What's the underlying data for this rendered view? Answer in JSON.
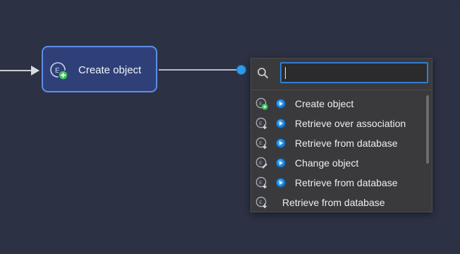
{
  "node": {
    "label": "Create object",
    "icon": "create-object-icon"
  },
  "search": {
    "value": "",
    "icon": "search-icon"
  },
  "colors": {
    "canvas": "#2c3244",
    "node_fill": "#2f4079",
    "node_border": "#5f8ee8",
    "accent": "#2e9bea",
    "popup_bg": "#3a3a3d"
  },
  "suggestions": [
    {
      "label": "Create object",
      "icon": "create-object-icon",
      "badge": true
    },
    {
      "label": "Retrieve over association",
      "icon": "retrieve-icon",
      "badge": true
    },
    {
      "label": "Retrieve from database",
      "icon": "retrieve-icon",
      "badge": true
    },
    {
      "label": "Change object",
      "icon": "change-object-icon",
      "badge": true
    },
    {
      "label": "Retrieve from database",
      "icon": "retrieve-icon",
      "badge": true
    },
    {
      "label": "Retrieve from database",
      "icon": "retrieve-icon",
      "badge": false
    }
  ]
}
